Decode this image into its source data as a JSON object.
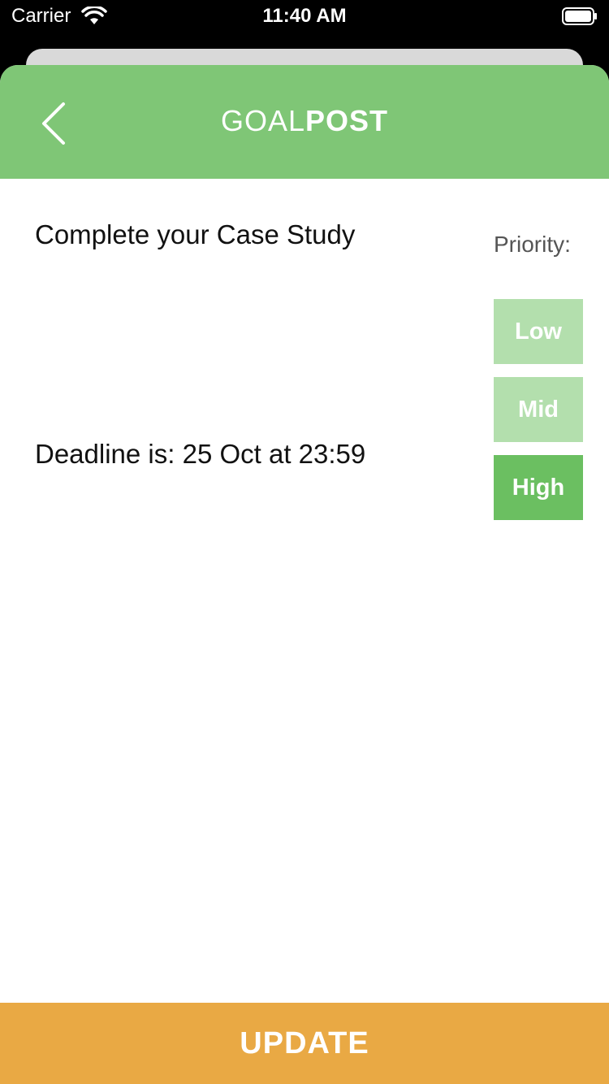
{
  "status_bar": {
    "carrier": "Carrier",
    "time": "11:40 AM"
  },
  "header": {
    "title_light": "GOAL",
    "title_bold": "POST",
    "background_color": "#7fc676"
  },
  "goal": {
    "text": "Complete your Case Study",
    "deadline": "Deadline is: 25 Oct at 23:59"
  },
  "priority": {
    "label": "Priority:",
    "options": [
      "Low",
      "Mid",
      "High"
    ],
    "selected": "High",
    "selected_color": "#6bbf61",
    "unselected_color": "#b3dfad"
  },
  "footer": {
    "update_label": "UPDATE",
    "color": "#e9a944"
  },
  "icons": [
    "wifi-icon",
    "battery-icon",
    "chevron-left-icon"
  ]
}
